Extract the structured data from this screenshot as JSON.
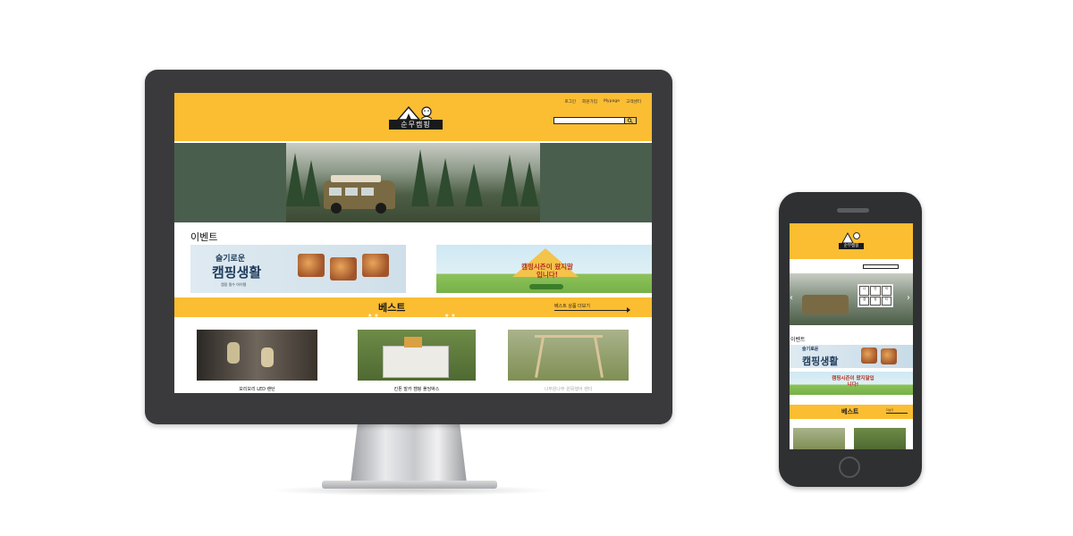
{
  "site": {
    "logo_text": "순무캠핑",
    "nav": [
      "로그인",
      "회원가입",
      "Mypage",
      "고객센터"
    ],
    "search_button": "🔍",
    "event_title": "이벤트",
    "banner1": {
      "small": "슬기로운",
      "big": "캠핑생활",
      "sub": "캠핑 필수 아이템"
    },
    "banner2": {
      "text": "캠핑시즌이 왔지말입니다!"
    },
    "best_title": "베스트",
    "best_more": "베스트 상품 더보기",
    "products": [
      {
        "name": "모리모리 LED 랜턴"
      },
      {
        "name": "킨톤 말카 캠핑 폴딩박스"
      },
      {
        "name": "나무원나무 원목행어 랜더"
      }
    ]
  },
  "mobile": {
    "logo_text": "순무캠핑",
    "event_title": "이벤트",
    "banner1_big": "캠핑생활",
    "banner1_small": "슬기로운",
    "banner2_text": "캠핑시즌이 왔지말입니다!",
    "best_title": "베스트",
    "best_more": "더보기",
    "sign_cells": [
      "나",
      "만",
      "의",
      "캠",
      "핑",
      "터"
    ]
  },
  "colors": {
    "brand_yellow": "#fbbd32",
    "dark_frame": "#3a3a3c",
    "hero_green": "#4a5e4d"
  }
}
